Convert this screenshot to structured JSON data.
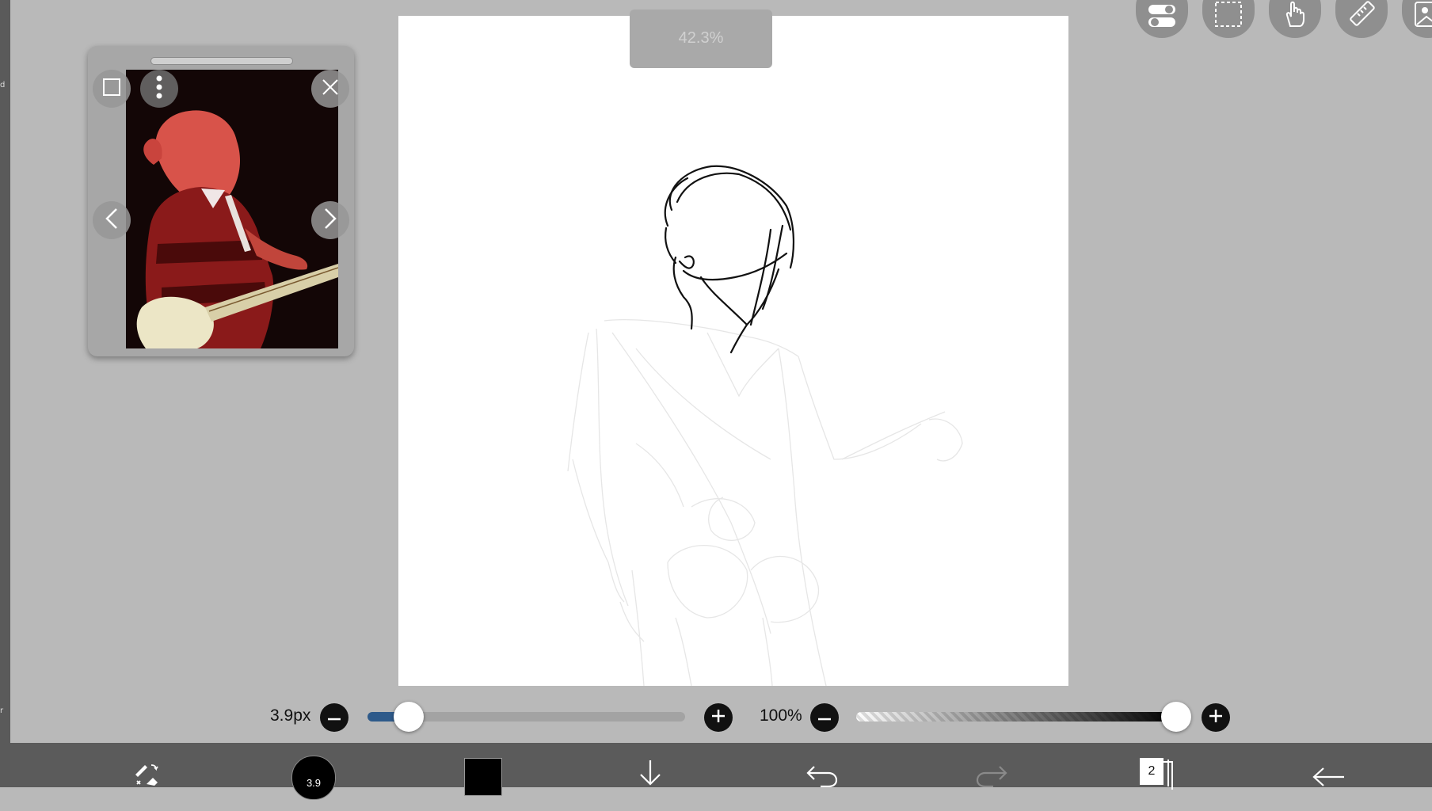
{
  "left_edge": {
    "mark1": "d",
    "mark2": "r"
  },
  "zoom": {
    "label": "42.3%"
  },
  "top_tools": [
    "layer-toggle-icon",
    "selection-icon",
    "hand-icon",
    "ruler-icon",
    "image-icon"
  ],
  "reference": {
    "icons": [
      "square-icon",
      "more-icon",
      "close-icon",
      "prev-icon",
      "next-icon"
    ]
  },
  "brush": {
    "size_label": "3.9px",
    "size_fraction": 0.13
  },
  "opacity": {
    "label": "100%",
    "fraction": 1.0
  },
  "toolbar": {
    "brush_badge": "3.9",
    "layer_count": "2",
    "color": "#000000",
    "items": [
      "pen-eraser-icon",
      "brush-size-icon",
      "color-swatch",
      "download-icon",
      "undo-icon",
      "redo-icon",
      "layers-icon",
      "back-icon"
    ]
  },
  "colors": {
    "background": "#b9b9b9",
    "toolbar": "#5b5b5b",
    "accent": "#2e5a8a"
  }
}
